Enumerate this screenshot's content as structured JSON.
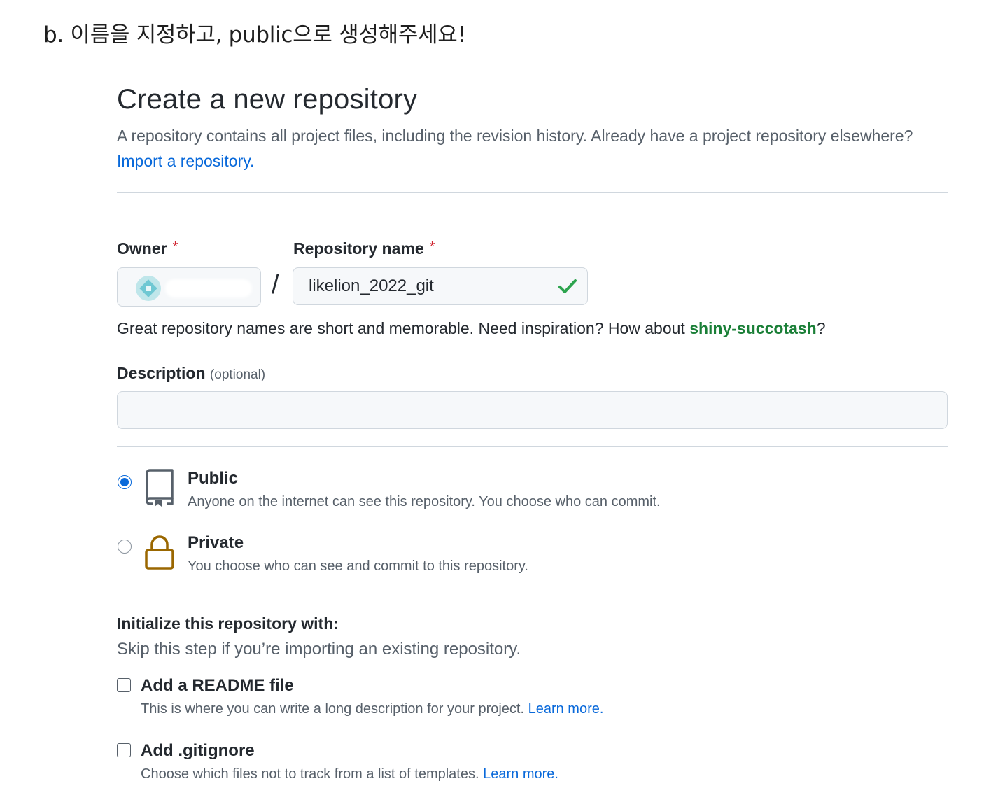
{
  "step_heading": "b.  이름을 지정하고, public으로 생성해주세요!",
  "page": {
    "title": "Create a new repository",
    "subtitle": "A repository contains all project files, including the revision history. Already have a project repository elsewhere?",
    "import_link": "Import a repository."
  },
  "owner": {
    "label": "Owner",
    "required_mark": "*"
  },
  "repo_name": {
    "label": "Repository name",
    "required_mark": "*",
    "value": "likelion_2022_git",
    "separator": "/"
  },
  "name_hint": {
    "text_before": "Great repository names are short and memorable. Need inspiration? How about ",
    "suggestion": "shiny-succotash",
    "text_after": "?"
  },
  "description": {
    "label": "Description",
    "optional": "(optional)",
    "value": ""
  },
  "visibility": {
    "selected": "public",
    "options": [
      {
        "title": "Public",
        "desc": "Anyone on the internet can see this repository. You choose who can commit.",
        "icon": "repo-icon"
      },
      {
        "title": "Private",
        "desc": "You choose who can see and commit to this repository.",
        "icon": "lock-icon"
      }
    ]
  },
  "init": {
    "title": "Initialize this repository with:",
    "subtitle": "Skip this step if you’re importing an existing repository.",
    "readme": {
      "title": "Add a README file",
      "desc": "This is where you can write a long description for your project.",
      "link": "Learn more.",
      "checked": false
    },
    "gitignore": {
      "title": "Add .gitignore",
      "desc": "Choose which files not to track from a list of templates.",
      "link": "Learn more.",
      "checked": false
    }
  },
  "colors": {
    "accent": "#0969da",
    "success": "#1a7f37",
    "required": "#cf222e",
    "lock": "#9a6700"
  }
}
